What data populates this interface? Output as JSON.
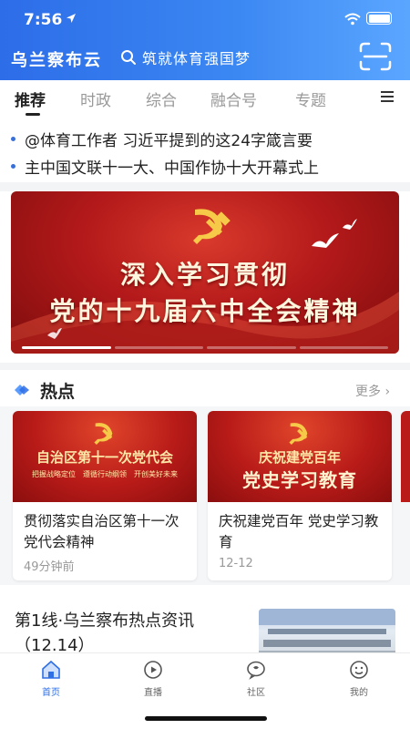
{
  "status_bar": {
    "time": "7:56"
  },
  "header": {
    "brand": "乌兰察布云",
    "search_placeholder": "筑就体育强国梦",
    "accent_color": "#2d6de8",
    "scan_icon": "scan-icon"
  },
  "tabs": [
    {
      "label": "推荐",
      "active": true
    },
    {
      "label": "时政"
    },
    {
      "label": "综合"
    },
    {
      "label": "融合号"
    },
    {
      "label": "专题"
    }
  ],
  "ticker": [
    "@体育工作者 习近平提到的这24字箴言要",
    "主中国文联十一大、中国作协十大开幕式上"
  ],
  "banner": {
    "line1": "深入学习贯彻",
    "line2": "党的十九届六中全会精神",
    "slides_total": 4,
    "active_slide": 1
  },
  "hot_section": {
    "title": "热点",
    "more_label": "更多 ›",
    "cards": [
      {
        "thumb_heading": "自治区第十一次党代会",
        "thumb_tags": "把握战略定位　遵循行动纲领　开创美好未来",
        "title": "贯彻落实自治区第十一次党代会精神",
        "time": "49分钟前"
      },
      {
        "thumb_heading": "庆祝建党百年",
        "thumb_heading2": "党史学习教育",
        "title": "庆祝建党百年 党史学习教育",
        "time": "12-12"
      }
    ]
  },
  "news": [
    {
      "title": "第1线·乌兰察布热点资讯（12.14）"
    }
  ],
  "bottom_nav": [
    {
      "label": "首页",
      "icon": "home-icon",
      "active": true
    },
    {
      "label": "直播",
      "icon": "live-icon"
    },
    {
      "label": "社区",
      "icon": "community-icon"
    },
    {
      "label": "我的",
      "icon": "profile-icon"
    }
  ],
  "colors": {
    "nav_active": "#2f6fe6",
    "party_red": "#b81b18"
  }
}
